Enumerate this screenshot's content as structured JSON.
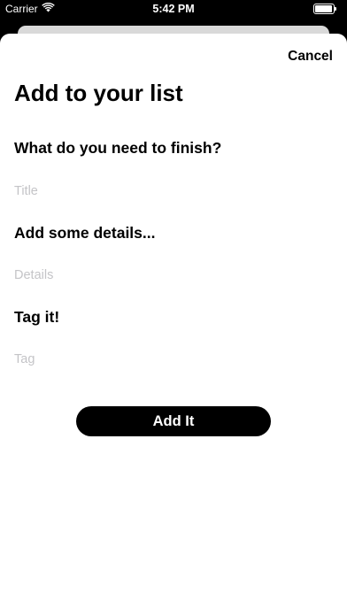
{
  "status_bar": {
    "carrier": "Carrier",
    "time": "5:42 PM",
    "wifi_icon": "wifi-icon",
    "battery_icon": "battery-icon"
  },
  "sheet": {
    "cancel_label": "Cancel",
    "title": "Add to your list",
    "title_field": {
      "label": "What do you need to finish?",
      "placeholder": "Title",
      "value": ""
    },
    "details_field": {
      "label": "Add some details...",
      "placeholder": "Details",
      "value": ""
    },
    "tag_field": {
      "label": "Tag it!",
      "placeholder": "Tag",
      "value": ""
    },
    "submit_label": "Add It"
  },
  "colors": {
    "background": "#000000",
    "sheet": "#ffffff",
    "placeholder": "#c4c4c7",
    "button": "#000000",
    "button_text": "#ffffff"
  }
}
